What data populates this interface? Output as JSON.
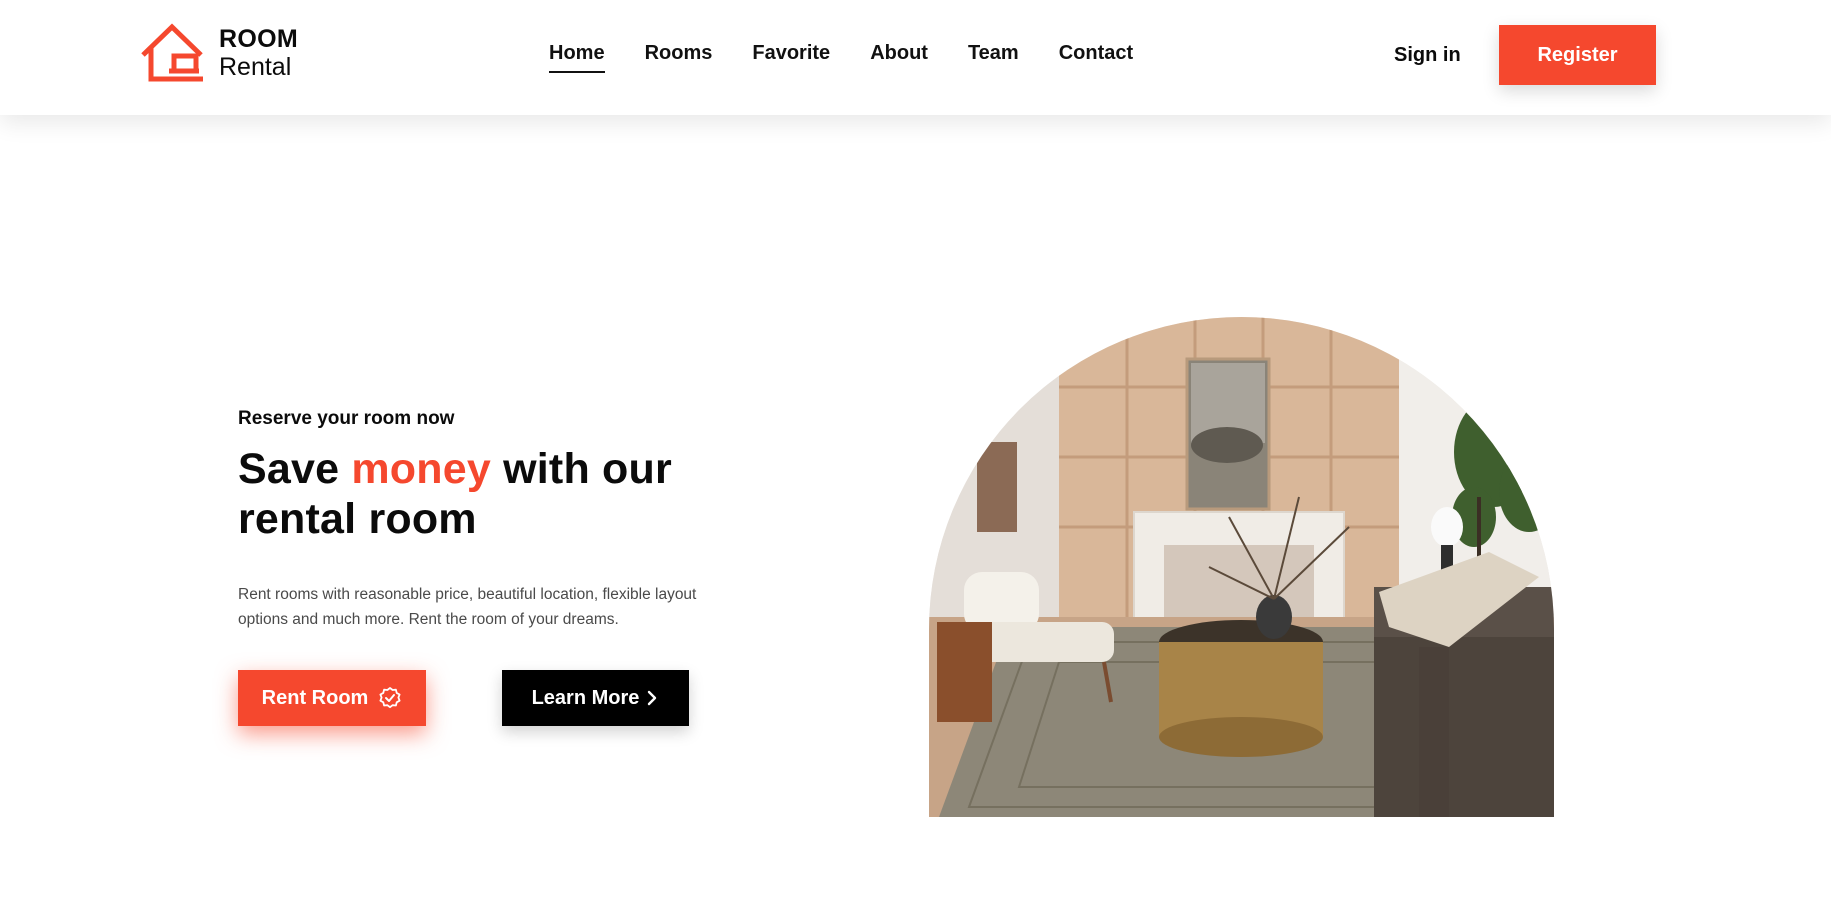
{
  "brand": {
    "line1": "ROOM",
    "line2": "Rental",
    "accent_color": "#f5482e",
    "icon": "house-icon"
  },
  "nav": {
    "items": [
      {
        "label": "Home",
        "active": true
      },
      {
        "label": "Rooms",
        "active": false
      },
      {
        "label": "Favorite",
        "active": false
      },
      {
        "label": "About",
        "active": false
      },
      {
        "label": "Team",
        "active": false
      },
      {
        "label": "Contact",
        "active": false
      }
    ],
    "signin_label": "Sign in",
    "register_label": "Register"
  },
  "hero": {
    "eyebrow": "Reserve your room now",
    "headline_part1": "Save ",
    "headline_accent": "money",
    "headline_part2": " with our",
    "headline_line2": "rental room",
    "description": "Rent rooms with reasonable price, beautiful location, flexible layout options and much more. Rent the room of your dreams.",
    "primary_button": {
      "label": "Rent Room",
      "icon": "badge-check-icon"
    },
    "secondary_button": {
      "label": "Learn More",
      "icon": "chevron-right-icon"
    },
    "image_subject": "living-room-photo"
  },
  "colors": {
    "accent": "#f5482e",
    "dark": "#000000",
    "text": "#0b0b0b",
    "muted": "#4a4a4a"
  }
}
